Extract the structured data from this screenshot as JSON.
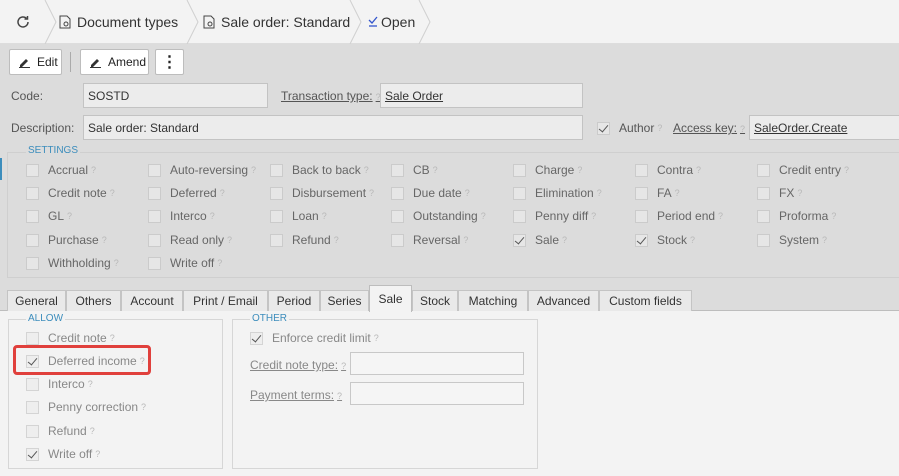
{
  "breadcrumb": {
    "items": [
      "Document types",
      "Sale order: Standard",
      "Open"
    ]
  },
  "toolbar": {
    "edit_label": "Edit",
    "amend_label": "Amend",
    "more_label": "⋮"
  },
  "form": {
    "code_label": "Code:",
    "code_value": "SOSTD",
    "transaction_type_label": "Transaction type:",
    "transaction_type_value": "Sale Order",
    "description_label": "Description:",
    "description_value": "Sale order: Standard",
    "author_label": "Author",
    "author_checked": true,
    "access_key_label": "Access key:",
    "access_key_value": "SaleOrder.Create"
  },
  "settings": {
    "legend": "SETTINGS",
    "rows": [
      [
        {
          "label": "Accrual",
          "checked": false
        },
        {
          "label": "Auto-reversing",
          "checked": false
        },
        {
          "label": "Back to back",
          "checked": false
        },
        {
          "label": "CB",
          "checked": false
        },
        {
          "label": "Charge",
          "checked": false
        },
        {
          "label": "Contra",
          "checked": false
        },
        {
          "label": "Credit entry",
          "checked": false
        }
      ],
      [
        {
          "label": "Credit note",
          "checked": false
        },
        {
          "label": "Deferred",
          "checked": false
        },
        {
          "label": "Disbursement",
          "checked": false
        },
        {
          "label": "Due date",
          "checked": false
        },
        {
          "label": "Elimination",
          "checked": false
        },
        {
          "label": "FA",
          "checked": false
        },
        {
          "label": "FX",
          "checked": false
        }
      ],
      [
        {
          "label": "GL",
          "checked": false
        },
        {
          "label": "Interco",
          "checked": false
        },
        {
          "label": "Loan",
          "checked": false
        },
        {
          "label": "Outstanding",
          "checked": false
        },
        {
          "label": "Penny diff",
          "checked": false
        },
        {
          "label": "Period end",
          "checked": false
        },
        {
          "label": "Proforma",
          "checked": false
        }
      ],
      [
        {
          "label": "Purchase",
          "checked": false
        },
        {
          "label": "Read only",
          "checked": false
        },
        {
          "label": "Refund",
          "checked": false
        },
        {
          "label": "Reversal",
          "checked": false
        },
        {
          "label": "Sale",
          "checked": true
        },
        {
          "label": "Stock",
          "checked": true
        },
        {
          "label": "System",
          "checked": false
        }
      ],
      [
        {
          "label": "Withholding",
          "checked": false
        },
        {
          "label": "Write off",
          "checked": false
        }
      ]
    ]
  },
  "tabs": [
    "General",
    "Others",
    "Account",
    "Print / Email",
    "Period",
    "Series",
    "Sale",
    "Stock",
    "Matching",
    "Advanced",
    "Custom fields"
  ],
  "active_tab": "Sale",
  "sale": {
    "allow_legend": "ALLOW",
    "allow_items": [
      {
        "label": "Credit note",
        "checked": false
      },
      {
        "label": "Deferred income",
        "checked": true
      },
      {
        "label": "Interco",
        "checked": false
      },
      {
        "label": "Penny correction",
        "checked": false
      },
      {
        "label": "Refund",
        "checked": false
      },
      {
        "label": "Write off",
        "checked": true
      }
    ],
    "other_legend": "OTHER",
    "enforce_credit_limit_label": "Enforce credit limit",
    "enforce_credit_limit_checked": true,
    "credit_note_type_label": "Credit note type:",
    "credit_note_type_value": "",
    "payment_terms_label": "Payment terms:",
    "payment_terms_value": ""
  },
  "help_mark": "?"
}
